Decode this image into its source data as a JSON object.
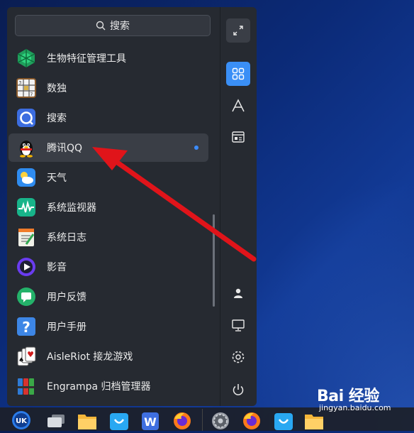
{
  "search": {
    "placeholder": "搜索"
  },
  "apps": [
    {
      "label": "生物特征管理工具",
      "icon": "biometric-icon"
    },
    {
      "label": "数独",
      "icon": "sudoku-icon"
    },
    {
      "label": "搜索",
      "icon": "search-app-icon"
    },
    {
      "label": "腾讯QQ",
      "icon": "qq-penguin-icon",
      "active": true,
      "new": true
    },
    {
      "label": "天气",
      "icon": "weather-icon"
    },
    {
      "label": "系统监视器",
      "icon": "system-monitor-icon"
    },
    {
      "label": "系统日志",
      "icon": "system-log-icon"
    },
    {
      "label": "影音",
      "icon": "media-player-icon"
    },
    {
      "label": "用户反馈",
      "icon": "feedback-icon"
    },
    {
      "label": "用户手册",
      "icon": "manual-icon"
    },
    {
      "label": "AisleRiot 接龙游戏",
      "icon": "solitaire-icon"
    },
    {
      "label": "Engrampa 归档管理器",
      "icon": "archive-manager-icon"
    }
  ],
  "sidebar": [
    "fullscreen-icon",
    "all-apps-icon",
    "letter-index-icon",
    "category-icon",
    "user-icon",
    "computer-icon",
    "settings-icon",
    "power-icon"
  ],
  "watermark": {
    "logo": "Bai  经验",
    "url": "jingyan.baidu.com"
  },
  "colors": {
    "accent": "#3a8ff6",
    "arrow": "#e0141a"
  }
}
